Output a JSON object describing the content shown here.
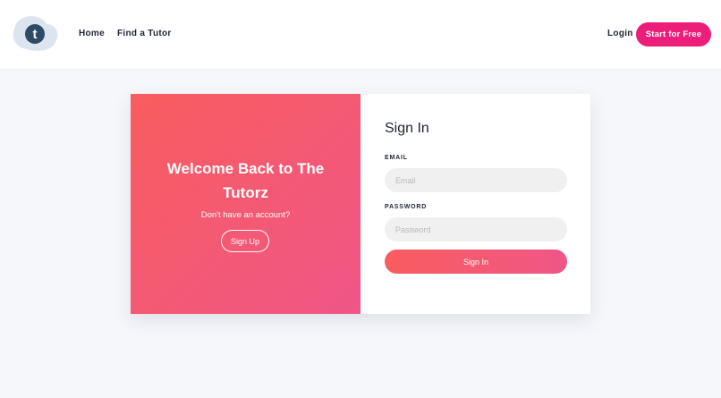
{
  "header": {
    "logo_letter": "t",
    "nav": [
      {
        "label": "Home"
      },
      {
        "label": "Find a Tutor"
      }
    ],
    "login_label": "Login",
    "cta_label": "Start for Free"
  },
  "welcome_panel": {
    "heading": "Welcome Back to The Tutorz",
    "subtext": "Don't have an account?",
    "signup_label": "Sign Up"
  },
  "signin_form": {
    "title": "Sign In",
    "email_label": "EMAIL",
    "email_placeholder": "Email",
    "email_value": "",
    "password_label": "PASSWORD",
    "password_placeholder": "Password",
    "password_value": "",
    "submit_label": "Sign In"
  },
  "colors": {
    "brand_pink": "#ec1e79",
    "gradient_start": "#f85d5e",
    "gradient_end": "#f05687",
    "logo_bg": "#dce4ef",
    "logo_circle": "#2d4a67"
  }
}
